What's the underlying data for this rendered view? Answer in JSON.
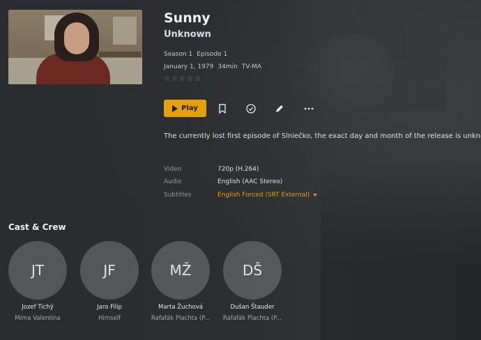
{
  "episode": {
    "title": "Sunny",
    "subtitle": "Unknown",
    "season": "Season 1",
    "episode": "Episode 1",
    "date": "January 1, 1979",
    "duration": "34min",
    "rating": "TV-MA",
    "stars": "☆☆☆☆☆",
    "summary": "The currently lost first episode of Slniečko, the exact day and month of the release is unknown."
  },
  "actions": {
    "play_label": "Play",
    "play_icon": "play-icon",
    "watchlist_icon": "bookmark-icon",
    "watched_icon": "check-circle-icon",
    "edit_icon": "pencil-icon",
    "more_icon": "more-icon"
  },
  "media": {
    "video_label": "Video",
    "video_value": "720p (H.264)",
    "audio_label": "Audio",
    "audio_value": "English (AAC Stereo)",
    "subtitles_label": "Subtitles",
    "subtitles_value": "English Forced (SRT External)"
  },
  "cast": {
    "heading": "Cast & Crew",
    "people": [
      {
        "initials": "JT",
        "name": "Jozef Tichý",
        "role": "Mima Valentína"
      },
      {
        "initials": "JF",
        "name": "Jaro Filip",
        "role": "Himself"
      },
      {
        "initials": "MŽ",
        "name": "Marta Žuchová",
        "role": "Rafafák Plachta (P..."
      },
      {
        "initials": "DŠ",
        "name": "Dušan Štauder",
        "role": "Rafafák Plachta (P..."
      }
    ]
  },
  "colors": {
    "accent": "#e5a00d",
    "background": "#2a2c2f"
  }
}
